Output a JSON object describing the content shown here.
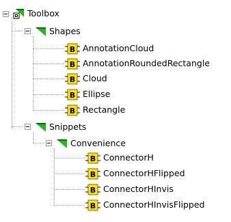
{
  "tree": {
    "root": {
      "label": "Toolbox",
      "icon": "toolbox-root-icon"
    },
    "groups": [
      {
        "label": "Shapes",
        "icon": "green-triangle-folder-icon",
        "items": [
          {
            "label": "AnnotationCloud",
            "icon": "b-block-icon"
          },
          {
            "label": "AnnotationRoundedRectangle",
            "icon": "b-block-icon"
          },
          {
            "label": "Cloud",
            "icon": "b-block-icon"
          },
          {
            "label": "Ellipse",
            "icon": "b-block-icon"
          },
          {
            "label": "Rectangle",
            "icon": "b-block-icon"
          }
        ]
      },
      {
        "label": "Snippets",
        "icon": "green-triangle-folder-icon",
        "subgroups": [
          {
            "label": "Convenience",
            "icon": "green-triangle-folder-icon",
            "items": [
              {
                "label": "ConnectorH",
                "icon": "b-block-icon"
              },
              {
                "label": "ConnectorHFlipped",
                "icon": "b-block-icon"
              },
              {
                "label": "ConnectorHInvis",
                "icon": "b-block-icon"
              },
              {
                "label": "ConnectorHInvisFlipped",
                "icon": "b-block-icon"
              }
            ]
          }
        ]
      }
    ]
  },
  "colors": {
    "triangle_green": "#1fb81f",
    "triangle_dark": "#0a6f0a",
    "b_yellow": "#ffe400",
    "b_border": "#8a6a00",
    "tree_line": "#a0a0a0"
  }
}
